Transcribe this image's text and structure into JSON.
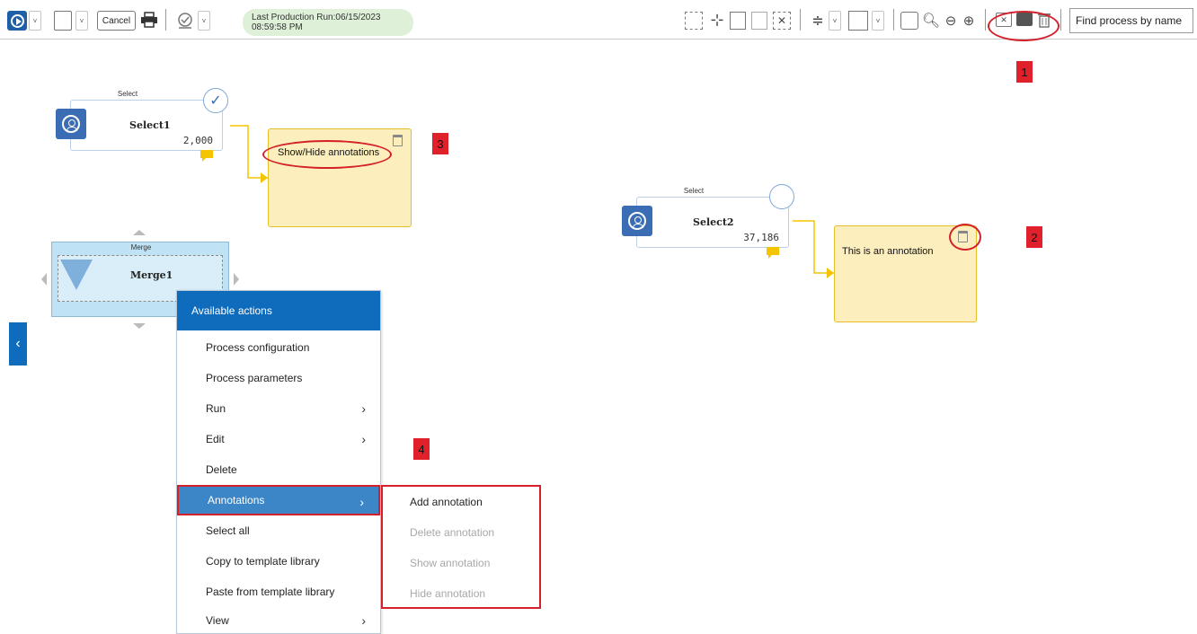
{
  "toolbar": {
    "cancel_label": "Cancel",
    "status_line1": "Last Production Run:06/15/2023",
    "status_line2": "08:59:58 PM",
    "search_placeholder": "Find process by name"
  },
  "markers": {
    "m1": "1",
    "m2": "2",
    "m3": "3",
    "m4": "4"
  },
  "nodes": {
    "select1": {
      "caption": "Select",
      "title": "Select1",
      "count": "2,000"
    },
    "select2": {
      "caption": "Select",
      "title": "Select2",
      "count": "37,186"
    },
    "merge1": {
      "caption": "Merge",
      "title": "Merge1"
    }
  },
  "annotations": {
    "a1_text": "Show/Hide annotations",
    "a2_text": "This is an annotation"
  },
  "context_menu": {
    "header": "Available actions",
    "items": [
      {
        "label": "Process configuration",
        "submenu": false
      },
      {
        "label": "Process parameters",
        "submenu": false
      },
      {
        "label": "Run",
        "submenu": true
      },
      {
        "label": "Edit",
        "submenu": true
      },
      {
        "label": "Delete",
        "submenu": false
      },
      {
        "label": "Annotations",
        "submenu": true,
        "active": true
      },
      {
        "label": "Select all",
        "submenu": false
      },
      {
        "label": "Copy to template library",
        "submenu": false
      },
      {
        "label": "Paste from template library",
        "submenu": false
      },
      {
        "label": "View",
        "submenu": true
      }
    ]
  },
  "submenu": {
    "items": [
      {
        "label": "Add annotation",
        "enabled": true
      },
      {
        "label": "Delete annotation",
        "enabled": false
      },
      {
        "label": "Show annotation",
        "enabled": false
      },
      {
        "label": "Hide annotation",
        "enabled": false
      }
    ]
  },
  "colors": {
    "accent": "#0f6cbd",
    "annotation_bg": "#fcefbd",
    "callout_red": "#e0202b"
  }
}
